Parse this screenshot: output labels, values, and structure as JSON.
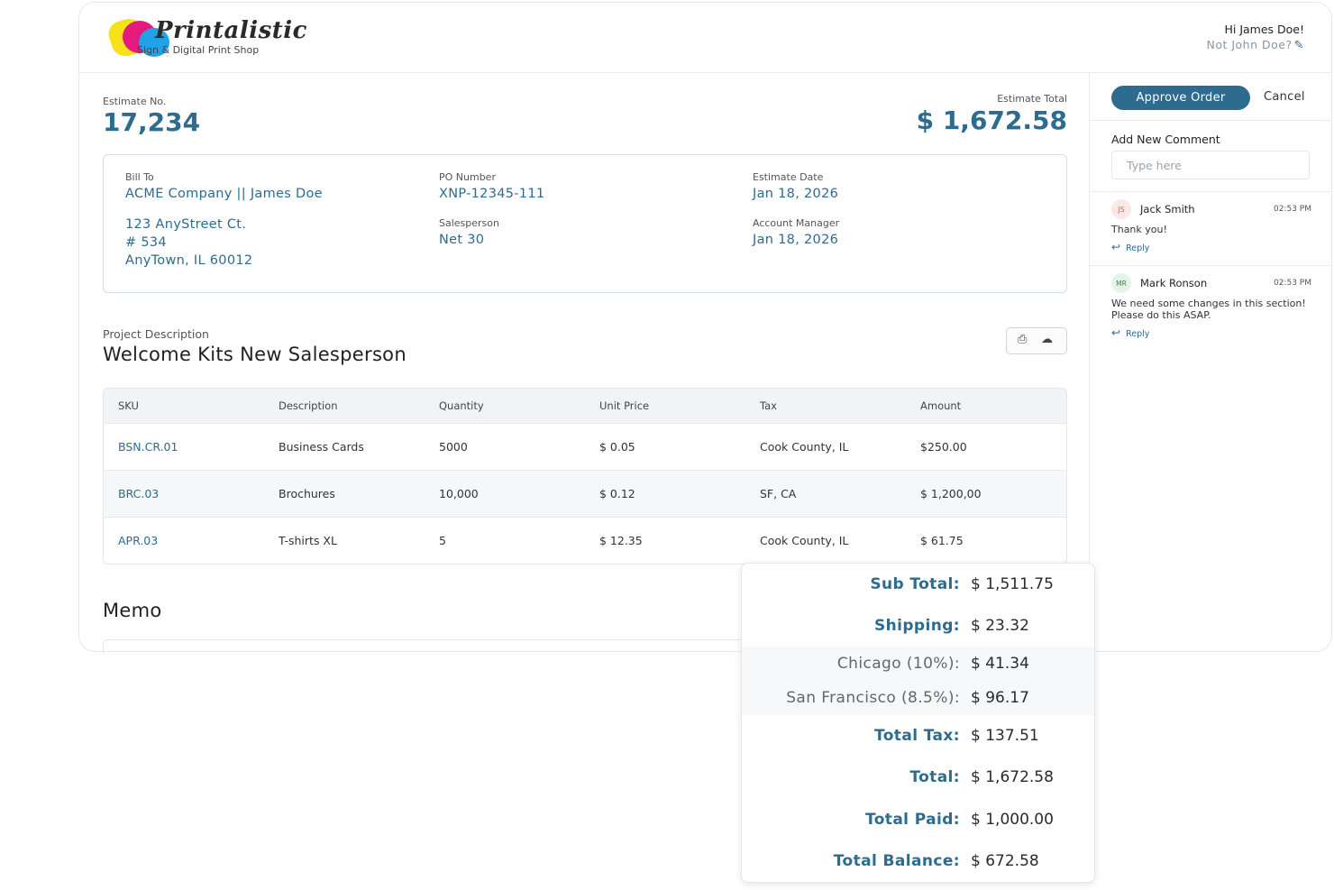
{
  "header": {
    "brand": "Printalistic",
    "tagline": "Sign & Digital Print Shop",
    "greeting": "Hi James Doe!",
    "not_you": "Not John Doe?",
    "edit_icon": "pencil-icon"
  },
  "estimate": {
    "number_label": "Estimate No.",
    "number": "17,234",
    "total_label": "Estimate Total",
    "total": "$ 1,672.58"
  },
  "billing": {
    "bill_to_label": "Bill To",
    "bill_to": "ACME Company || James Doe",
    "address": [
      "123 AnyStreet Ct.",
      "# 534",
      "AnyTown, IL 60012"
    ],
    "po_label": "PO Number",
    "po": "XNP-12345-111",
    "salesperson_label": "Salesperson",
    "salesperson": "Net 30",
    "date_label": "Estimate Date",
    "date": "Jan 18, 2026",
    "manager_label": "Account Manager",
    "manager": "Jan 18, 2026"
  },
  "project": {
    "label": "Project Description",
    "title": "Welcome Kits New Salesperson",
    "tools": [
      "print-icon",
      "cloud-download-icon"
    ]
  },
  "table": {
    "columns": [
      "SKU",
      "Description",
      "Quantity",
      "Unit Price",
      "Tax",
      "Amount"
    ],
    "rows": [
      [
        "BSN.CR.01",
        "Business Cards",
        "5000",
        "$ 0.05",
        "Cook County, IL",
        "$250.00"
      ],
      [
        "BRC.03",
        "Brochures",
        "10,000",
        "$ 0.12",
        "SF, CA",
        "$ 1,200,00"
      ],
      [
        "APR.03",
        "T-shirts XL",
        "5",
        "$ 12.35",
        "Cook County, IL",
        "$ 61.75"
      ]
    ]
  },
  "memo": {
    "title": "Memo"
  },
  "sidebar": {
    "approve_label": "Approve Order",
    "cancel_label": "Cancel",
    "add_comment_label": "Add New Comment",
    "comment_placeholder": "Type here",
    "comments": [
      {
        "initials": "JS",
        "name": "Jack Smith",
        "time": "02:53 PM",
        "text": "Thank you!",
        "reply": "Reply"
      },
      {
        "initials": "MR",
        "name": "Mark Ronson",
        "time": "02:53 PM",
        "text": "We need some changes in this section! Please do this ASAP.",
        "reply": "Reply"
      }
    ]
  },
  "totals": [
    {
      "label": "Sub Total:",
      "value": "$ 1,511.75",
      "kind": "main"
    },
    {
      "label": "Shipping:",
      "value": "$ 23.32",
      "kind": "main"
    },
    {
      "label": "Chicago (10%):",
      "value": "$ 41.34",
      "kind": "tax"
    },
    {
      "label": "San Francisco (8.5%):",
      "value": "$ 96.17",
      "kind": "tax"
    },
    {
      "label": "Total Tax:",
      "value": "$ 137.51",
      "kind": "main"
    },
    {
      "label": "Total:",
      "value": "$ 1,672.58",
      "kind": "main"
    },
    {
      "label": "Total Paid:",
      "value": "$ 1,000.00",
      "kind": "main"
    },
    {
      "label": "Total Balance:",
      "value": "$ 672.58",
      "kind": "main"
    }
  ],
  "colors": {
    "accent": "#2d6b8f"
  }
}
